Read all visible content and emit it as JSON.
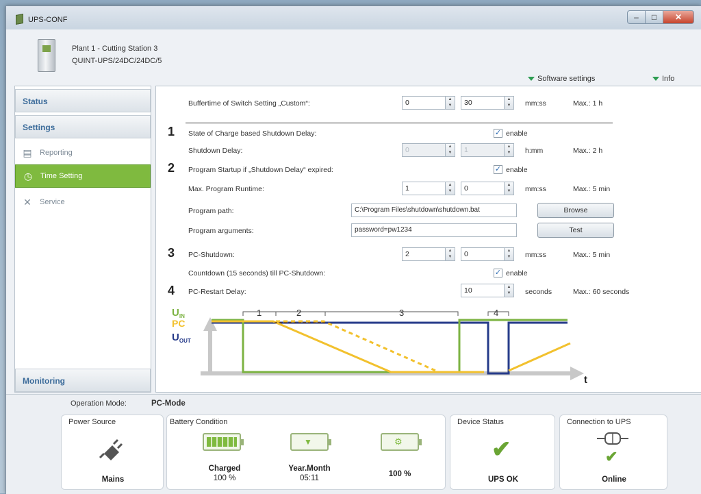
{
  "window": {
    "title": "UPS-CONF",
    "controls": {
      "minimize": "–",
      "maximize": "□",
      "close": "✕"
    }
  },
  "device": {
    "name": "Plant 1 - Cutting Station 3",
    "model": "QUINT-UPS/24DC/24DC/5"
  },
  "header_links": {
    "software_settings": "Software settings",
    "info": "Info"
  },
  "sidebar": {
    "status": "Status",
    "settings": "Settings",
    "reporting": "Reporting",
    "time_setting": "Time Setting",
    "service": "Service",
    "monitoring": "Monitoring"
  },
  "form": {
    "buffertime": {
      "label": "Buffertime of Switch Setting „Custom“:",
      "v1": "0",
      "v2": "30",
      "unit": "mm:ss",
      "max": "Max.: 1 h"
    },
    "step1": "1",
    "soc_shutdown": {
      "label": "State of Charge based Shutdown Delay:",
      "check_label": "enable"
    },
    "shutdown_delay": {
      "label": "Shutdown Delay:",
      "v1": "0",
      "v2": "1",
      "unit": "h:mm",
      "max": "Max.: 2 h"
    },
    "step2": "2",
    "program_startup": {
      "label": "Program Startup if „Shutdown Delay“ expired:",
      "check_label": "enable"
    },
    "max_runtime": {
      "label": "Max. Program Runtime:",
      "v1": "1",
      "v2": "0",
      "unit": "mm:ss",
      "max": "Max.: 5 min"
    },
    "program_path": {
      "label": "Program path:",
      "value": "C:\\Program Files\\shutdown\\shutdown.bat",
      "button": "Browse"
    },
    "program_args": {
      "label": "Program arguments:",
      "value": "password=pw1234",
      "button": "Test"
    },
    "step3": "3",
    "pc_shutdown": {
      "label": "PC-Shutdown:",
      "v1": "2",
      "v2": "0",
      "unit": "mm:ss",
      "max": "Max.: 5 min"
    },
    "countdown": {
      "label": "Countdown (15 seconds) till PC-Shutdown:",
      "check_label": "enable"
    },
    "step4": "4",
    "restart_delay": {
      "label": "PC-Restart Delay:",
      "v1": "10",
      "unit": "seconds",
      "max": "Max.: 60 seconds"
    }
  },
  "diagram": {
    "legend_uin": "U",
    "legend_uin_sub": "IN",
    "legend_pc": "PC",
    "legend_uout": "U",
    "legend_uout_sub": "OUT",
    "phase_1": "1",
    "phase_2": "2",
    "phase_3": "3",
    "phase_4": "4",
    "t_label": "t",
    "colors": {
      "uin": "#7cb342",
      "pc": "#f2c12e",
      "uout": "#263b8a",
      "axis": "#c8c8c8"
    }
  },
  "operation": {
    "label": "Operation Mode:",
    "value": "PC-Mode"
  },
  "panels": {
    "power_source": {
      "title": "Power Source",
      "value": "Mains"
    },
    "battery": {
      "title": "Battery Condition",
      "charged_label": "Charged",
      "charged_value": "100 %",
      "date_label": "Year.Month",
      "date_value": "05:11",
      "health_value": "100 %"
    },
    "device_status": {
      "title": "Device Status",
      "value": "UPS OK"
    },
    "connection": {
      "title": "Connection to UPS",
      "value": "Online"
    }
  }
}
